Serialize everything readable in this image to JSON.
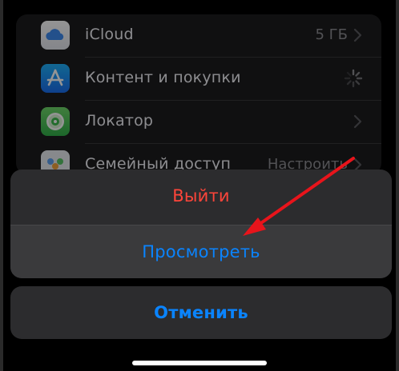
{
  "settings_list": {
    "rows": [
      {
        "label": "iCloud",
        "value": "5 ГБ",
        "icon": "icloud-icon",
        "accessory": "chevron"
      },
      {
        "label": "Контент и покупки",
        "value": "",
        "icon": "app-store-icon",
        "accessory": "spinner"
      },
      {
        "label": "Локатор",
        "value": "",
        "icon": "find-my-icon",
        "accessory": "chevron"
      },
      {
        "label": "Семейный доступ",
        "value": "Настроить",
        "icon": "family-sharing-icon",
        "accessory": "chevron"
      }
    ]
  },
  "action_sheet": {
    "sign_out_label": "Выйти",
    "view_label": "Просмотреть",
    "cancel_label": "Отменить"
  },
  "colors": {
    "destructive": "#ff453a",
    "accent": "#0a84ff",
    "annotation_arrow": "#e8141b",
    "background": "#000000",
    "sheet": "#2c2c2e"
  },
  "annotation": {
    "type": "arrow",
    "color": "#e8141b",
    "points_to": "view-button"
  }
}
